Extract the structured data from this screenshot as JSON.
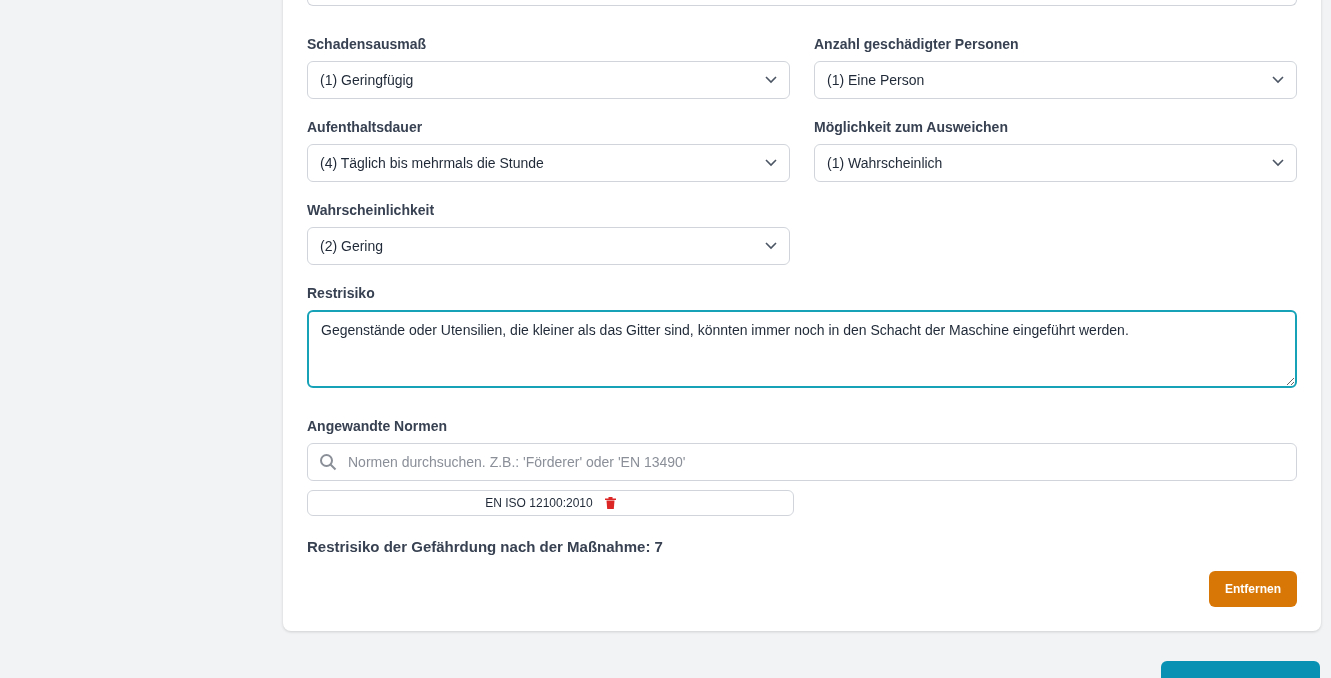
{
  "selects": [
    {
      "label": "Schadensausmaß",
      "value": "(1) Geringfügig"
    },
    {
      "label": "Anzahl geschädigter Personen",
      "value": "(1) Eine Person"
    },
    {
      "label": "Aufenthaltsdauer",
      "value": "(4) Täglich bis mehrmals die Stunde"
    },
    {
      "label": "Möglichkeit zum Ausweichen",
      "value": "(1) Wahrscheinlich"
    },
    {
      "label": "Wahrscheinlichkeit",
      "value": "(2) Gering"
    }
  ],
  "residual_risk": {
    "label": "Restrisiko",
    "value": "Gegenstände oder Utensilien, die kleiner als das Gitter sind, könnten immer noch in den Schacht der Maschine eingeführt werden.",
    "focused": true
  },
  "standards": {
    "label": "Angewandte Normen",
    "placeholder": "Normen durchsuchen. Z.B.: 'Förderer' oder 'EN 13490'",
    "items": [
      "EN ISO 12100:2010"
    ]
  },
  "result": "Restrisiko der Gefährdung nach der Maßnahme: **7**",
  "remove_button": "Entfernen"
}
